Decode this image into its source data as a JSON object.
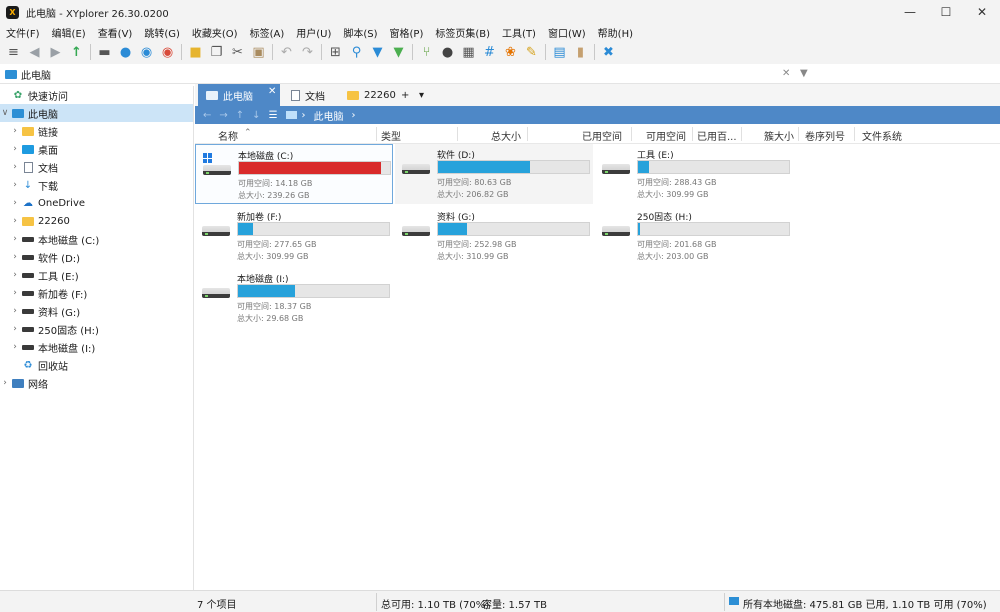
{
  "window": {
    "title": "此电脑 - XYplorer 26.30.0200",
    "logo": "X",
    "minimize": "—",
    "maximize": "☐",
    "close": "✕"
  },
  "menu": [
    "文件(F)",
    "编辑(E)",
    "查看(V)",
    "跳转(G)",
    "收藏夹(O)",
    "标签(A)",
    "用户(U)",
    "脚本(S)",
    "窗格(P)",
    "标签页集(B)",
    "工具(T)",
    "窗口(W)",
    "帮助(H)"
  ],
  "toolbar": {
    "icons": [
      "menu-icon",
      "back-icon",
      "forward-icon",
      "up-icon",
      "computer-icon",
      "location-icon",
      "find-icon",
      "go-icon",
      "new-folder-icon",
      "copy-icon",
      "cut-icon",
      "paste-icon",
      "undo-icon",
      "redo-icon",
      "grid-icon",
      "search-icon",
      "filter-icon",
      "filter-green-icon",
      "branch-icon",
      "dark-mode-icon",
      "calculator-icon",
      "hash-icon",
      "colors-icon",
      "brush-icon",
      "split-pane-icon",
      "bookmark-icon",
      "tools-icon"
    ]
  },
  "address": {
    "text": "此电脑",
    "clear": "✕",
    "filter": "▼"
  },
  "tree": [
    {
      "label": "快速访问",
      "icon": "quick-access-icon",
      "arrow": "",
      "indent": 0
    },
    {
      "label": "此电脑",
      "icon": "computer-icon",
      "arrow": "∨",
      "indent": 0,
      "selected": true
    },
    {
      "label": "链接",
      "icon": "folder-icon",
      "arrow": "›",
      "indent": 1
    },
    {
      "label": "桌面",
      "icon": "desktop-icon",
      "arrow": "›",
      "indent": 1
    },
    {
      "label": "文档",
      "icon": "document-icon",
      "arrow": "›",
      "indent": 1
    },
    {
      "label": "下载",
      "icon": "download-icon",
      "arrow": "›",
      "indent": 1
    },
    {
      "label": "OneDrive",
      "icon": "cloud-icon",
      "arrow": "›",
      "indent": 1
    },
    {
      "label": "22260",
      "icon": "folder-icon",
      "arrow": "›",
      "indent": 1
    },
    {
      "label": "本地磁盘 (C:)",
      "icon": "drive-icon",
      "arrow": "›",
      "indent": 1
    },
    {
      "label": "软件 (D:)",
      "icon": "drive-icon",
      "arrow": "›",
      "indent": 1
    },
    {
      "label": "工具 (E:)",
      "icon": "drive-icon",
      "arrow": "›",
      "indent": 1
    },
    {
      "label": "新加卷 (F:)",
      "icon": "drive-icon",
      "arrow": "›",
      "indent": 1
    },
    {
      "label": "资料 (G:)",
      "icon": "drive-icon",
      "arrow": "›",
      "indent": 1
    },
    {
      "label": "250固态 (H:)",
      "icon": "drive-icon",
      "arrow": "›",
      "indent": 1
    },
    {
      "label": "本地磁盘 (I:)",
      "icon": "drive-icon",
      "arrow": "›",
      "indent": 1
    },
    {
      "label": "回收站",
      "icon": "recycle-bin-icon",
      "arrow": "",
      "indent": 1
    },
    {
      "label": "网络",
      "icon": "network-icon",
      "arrow": "›",
      "indent": 0
    }
  ],
  "tabs": [
    {
      "label": "此电脑",
      "active": true,
      "close": "✕"
    },
    {
      "label": "文档",
      "active": false
    },
    {
      "label": "22260",
      "active": false
    }
  ],
  "tab_controls": {
    "add": "+",
    "menu": "▾"
  },
  "nav": {
    "back": "←",
    "forward": "→",
    "up": "↑",
    "down": "↓",
    "list": "☰",
    "location": "此电脑",
    "sep": "›"
  },
  "columns": [
    {
      "label": "名称",
      "sort": "⌃"
    },
    {
      "label": "类型"
    },
    {
      "label": "总大小"
    },
    {
      "label": "已用空间"
    },
    {
      "label": "可用空间"
    },
    {
      "label": "已用百..."
    },
    {
      "label": "簇大小"
    },
    {
      "label": "卷序列号"
    },
    {
      "label": "文件系统"
    }
  ],
  "drives": [
    {
      "name": "本地磁盘 (C:)",
      "free": "可用空间: 14.18 GB",
      "total": "总大小: 239.26 GB",
      "used_fraction": 0.94,
      "system": true
    },
    {
      "name": "软件 (D:)",
      "free": "可用空间: 80.63 GB",
      "total": "总大小: 206.82 GB",
      "used_fraction": 0.61
    },
    {
      "name": "工具 (E:)",
      "free": "可用空间: 288.43 GB",
      "total": "总大小: 309.99 GB",
      "used_fraction": 0.07
    },
    {
      "name": "新加卷 (F:)",
      "free": "可用空间: 277.65 GB",
      "total": "总大小: 309.99 GB",
      "used_fraction": 0.1
    },
    {
      "name": "资料 (G:)",
      "free": "可用空间: 252.98 GB",
      "total": "总大小: 310.99 GB",
      "used_fraction": 0.19
    },
    {
      "name": "250固态 (H:)",
      "free": "可用空间: 201.68 GB",
      "total": "总大小: 203.00 GB",
      "used_fraction": 0.01
    },
    {
      "name": "本地磁盘 (I:)",
      "free": "可用空间: 18.37 GB",
      "total": "总大小: 29.68 GB",
      "used_fraction": 0.38
    }
  ],
  "status": {
    "items": "7 个项目",
    "free": "总可用: 1.10 TB (70%)",
    "capacity": "容量: 1.57 TB",
    "all_drives": "所有本地磁盘: 475.81 GB 已用, 1.10 TB 可用 (70%)"
  },
  "colors": {
    "accent": "#4e88c7",
    "bar": "#27a2db",
    "bar_full": "#d92b2b"
  }
}
